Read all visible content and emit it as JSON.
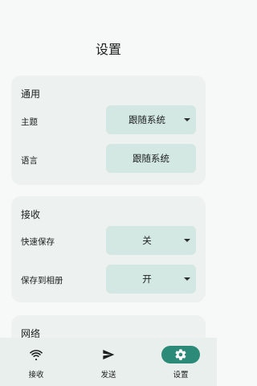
{
  "header": {
    "title": "设置"
  },
  "general": {
    "title": "通用",
    "theme": {
      "label": "主题",
      "value": "跟随系统"
    },
    "language": {
      "label": "语言",
      "value": "跟随系统"
    }
  },
  "receive": {
    "title": "接收",
    "quick_save": {
      "label": "快速保存",
      "value": "关"
    },
    "save_to_album": {
      "label": "保存到相册",
      "value": "开"
    }
  },
  "network": {
    "title": "网络"
  },
  "bottom_nav": {
    "items": [
      {
        "label": "接收",
        "icon": "wifi-icon"
      },
      {
        "label": "发送",
        "icon": "send-icon"
      },
      {
        "label": "设置",
        "icon": "gear-icon",
        "active": true
      }
    ]
  },
  "colors": {
    "accent": "#2c8a78",
    "select_bg": "#d4e8e3",
    "card_bg": "#edf1ef"
  }
}
